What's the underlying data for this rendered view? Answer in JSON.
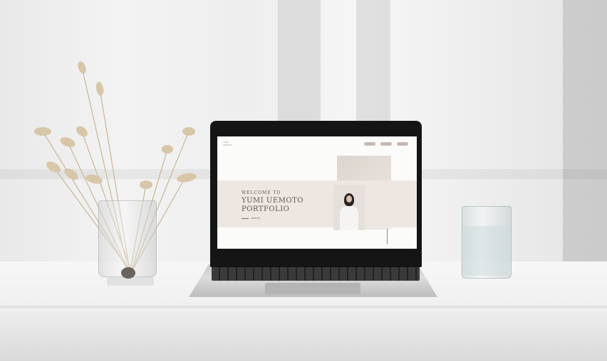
{
  "scene": {
    "description_free": true
  },
  "website": {
    "logo_line1": "YUMI",
    "logo_line2": "UEMOTO",
    "welcome": "WELCOME TO",
    "name_line1": "YUMI UEMOTO",
    "name_line2": "PORTFOLIO",
    "sub_label": "WEBSITE",
    "nav": [
      "",
      "",
      ""
    ]
  },
  "colors": {
    "band": "#eee7e1",
    "text": "#5e5550",
    "nav_pill": "#c5b9b2"
  }
}
